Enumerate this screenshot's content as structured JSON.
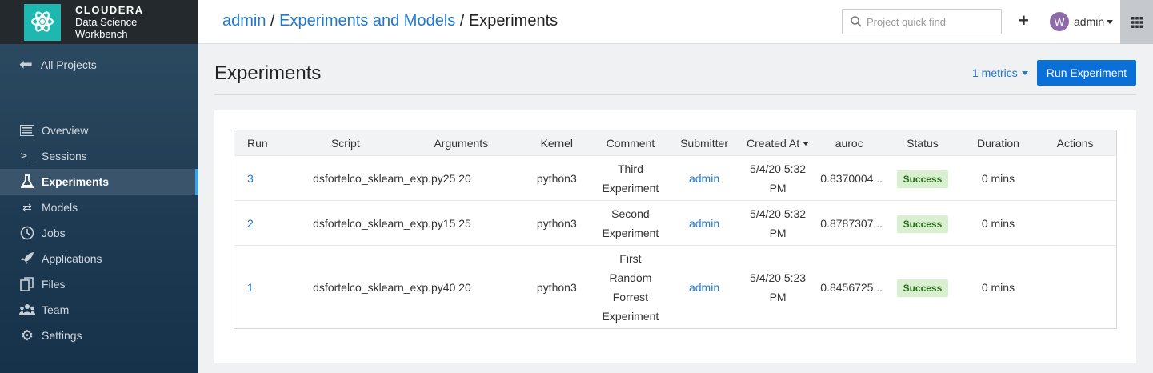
{
  "logo": {
    "brand": "CLOUDERA",
    "line2": "Data Science",
    "line3": "Workbench"
  },
  "sidebar": {
    "back_label": "All Projects",
    "items": [
      {
        "label": "Overview",
        "icon": "overview-icon"
      },
      {
        "label": "Sessions",
        "icon": "terminal-icon"
      },
      {
        "label": "Experiments",
        "icon": "flask-icon",
        "active": true
      },
      {
        "label": "Models",
        "icon": "arrows-icon"
      },
      {
        "label": "Jobs",
        "icon": "clock-icon"
      },
      {
        "label": "Applications",
        "icon": "rocket-icon"
      },
      {
        "label": "Files",
        "icon": "files-icon"
      },
      {
        "label": "Team",
        "icon": "team-icon"
      },
      {
        "label": "Settings",
        "icon": "gear-icon"
      }
    ]
  },
  "header": {
    "breadcrumb": {
      "user": "admin",
      "project": "Experiments and Models",
      "current": "Experiments",
      "sep": "/"
    },
    "search_placeholder": "Project quick find",
    "user_initial": "W",
    "user_name": "admin"
  },
  "main": {
    "title": "Experiments",
    "metrics_label": "1 metrics",
    "run_button": "Run Experiment",
    "columns": [
      "Run",
      "Script",
      "Arguments",
      "Kernel",
      "Comment",
      "Submitter",
      "Created At",
      "auroc",
      "Status",
      "Duration",
      "Actions"
    ],
    "rows": [
      {
        "run": "3",
        "script": "dsfortelco_sklearn_exp.py",
        "args": "25 20",
        "kernel": "python3",
        "comment": [
          "Third",
          "Experiment"
        ],
        "submitter": "admin",
        "created": [
          "5/4/20 5:32",
          "PM"
        ],
        "auroc": "0.8370004...",
        "status": "Success",
        "duration": "0 mins"
      },
      {
        "run": "2",
        "script": "dsfortelco_sklearn_exp.py",
        "args": "15 25",
        "kernel": "python3",
        "comment": [
          "Second",
          "Experiment"
        ],
        "submitter": "admin",
        "created": [
          "5/4/20 5:32",
          "PM"
        ],
        "auroc": "0.8787307...",
        "status": "Success",
        "duration": "0 mins"
      },
      {
        "run": "1",
        "script": "dsfortelco_sklearn_exp.py",
        "args": "40 20",
        "kernel": "python3",
        "comment": [
          "First",
          "Random",
          "Forrest",
          "Experiment"
        ],
        "submitter": "admin",
        "created": [
          "5/4/20 5:23",
          "PM"
        ],
        "auroc": "0.8456725...",
        "status": "Success",
        "duration": "0 mins"
      }
    ]
  }
}
